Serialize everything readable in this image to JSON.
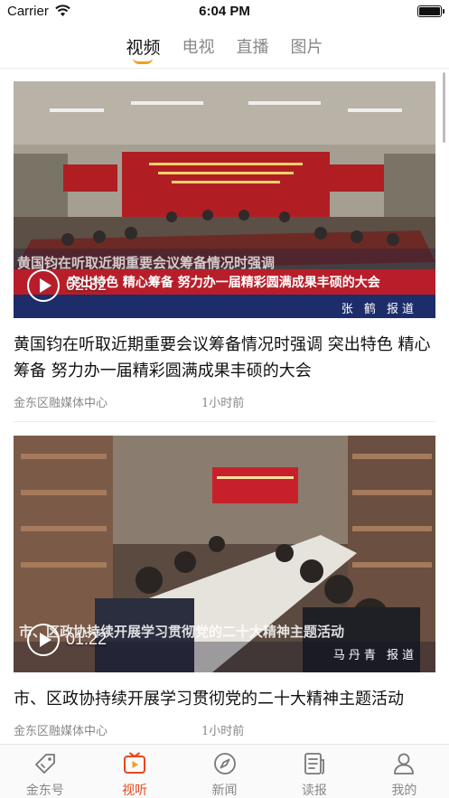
{
  "status_bar": {
    "carrier": "Carrier",
    "time": "6:04 PM"
  },
  "top_tabs": [
    {
      "label": "视频",
      "active": true
    },
    {
      "label": "电视",
      "active": false
    },
    {
      "label": "直播",
      "active": false
    },
    {
      "label": "图片",
      "active": false
    }
  ],
  "accent_color": "#e8471e",
  "tab_indicator_color": "#f0a020",
  "feed": [
    {
      "duration": "02:32",
      "overlay_caption_top": "黄国钧在听取近期重要会议筹备情况时强调",
      "overlay_caption_bottom": "突出特色 精心筹备 努力办一届精彩圆满成果丰硕的大会",
      "reporter": "张 鹤  报道",
      "title": "黄国钧在听取近期重要会议筹备情况时强调 突出特色 精心筹备 努力办一届精彩圆满成果丰硕的大会",
      "source": "金东区融媒体中心",
      "time": "1小时前"
    },
    {
      "duration": "01:22",
      "overlay_caption_top": "市、区政协持续开展学习贯彻党的二十大精神主题活动",
      "overlay_caption_bottom": "",
      "reporter": "马丹青  报道",
      "title": "市、区政协持续开展学习贯彻党的二十大精神主题活动",
      "source": "金东区融媒体中心",
      "time": "1小时前"
    }
  ],
  "bottom_nav": [
    {
      "label": "金东号",
      "icon": "tag-icon",
      "active": false
    },
    {
      "label": "视听",
      "icon": "tv-play-icon",
      "active": true
    },
    {
      "label": "新闻",
      "icon": "compass-icon",
      "active": false
    },
    {
      "label": "读报",
      "icon": "newspaper-icon",
      "active": false
    },
    {
      "label": "我的",
      "icon": "person-icon",
      "active": false
    }
  ]
}
